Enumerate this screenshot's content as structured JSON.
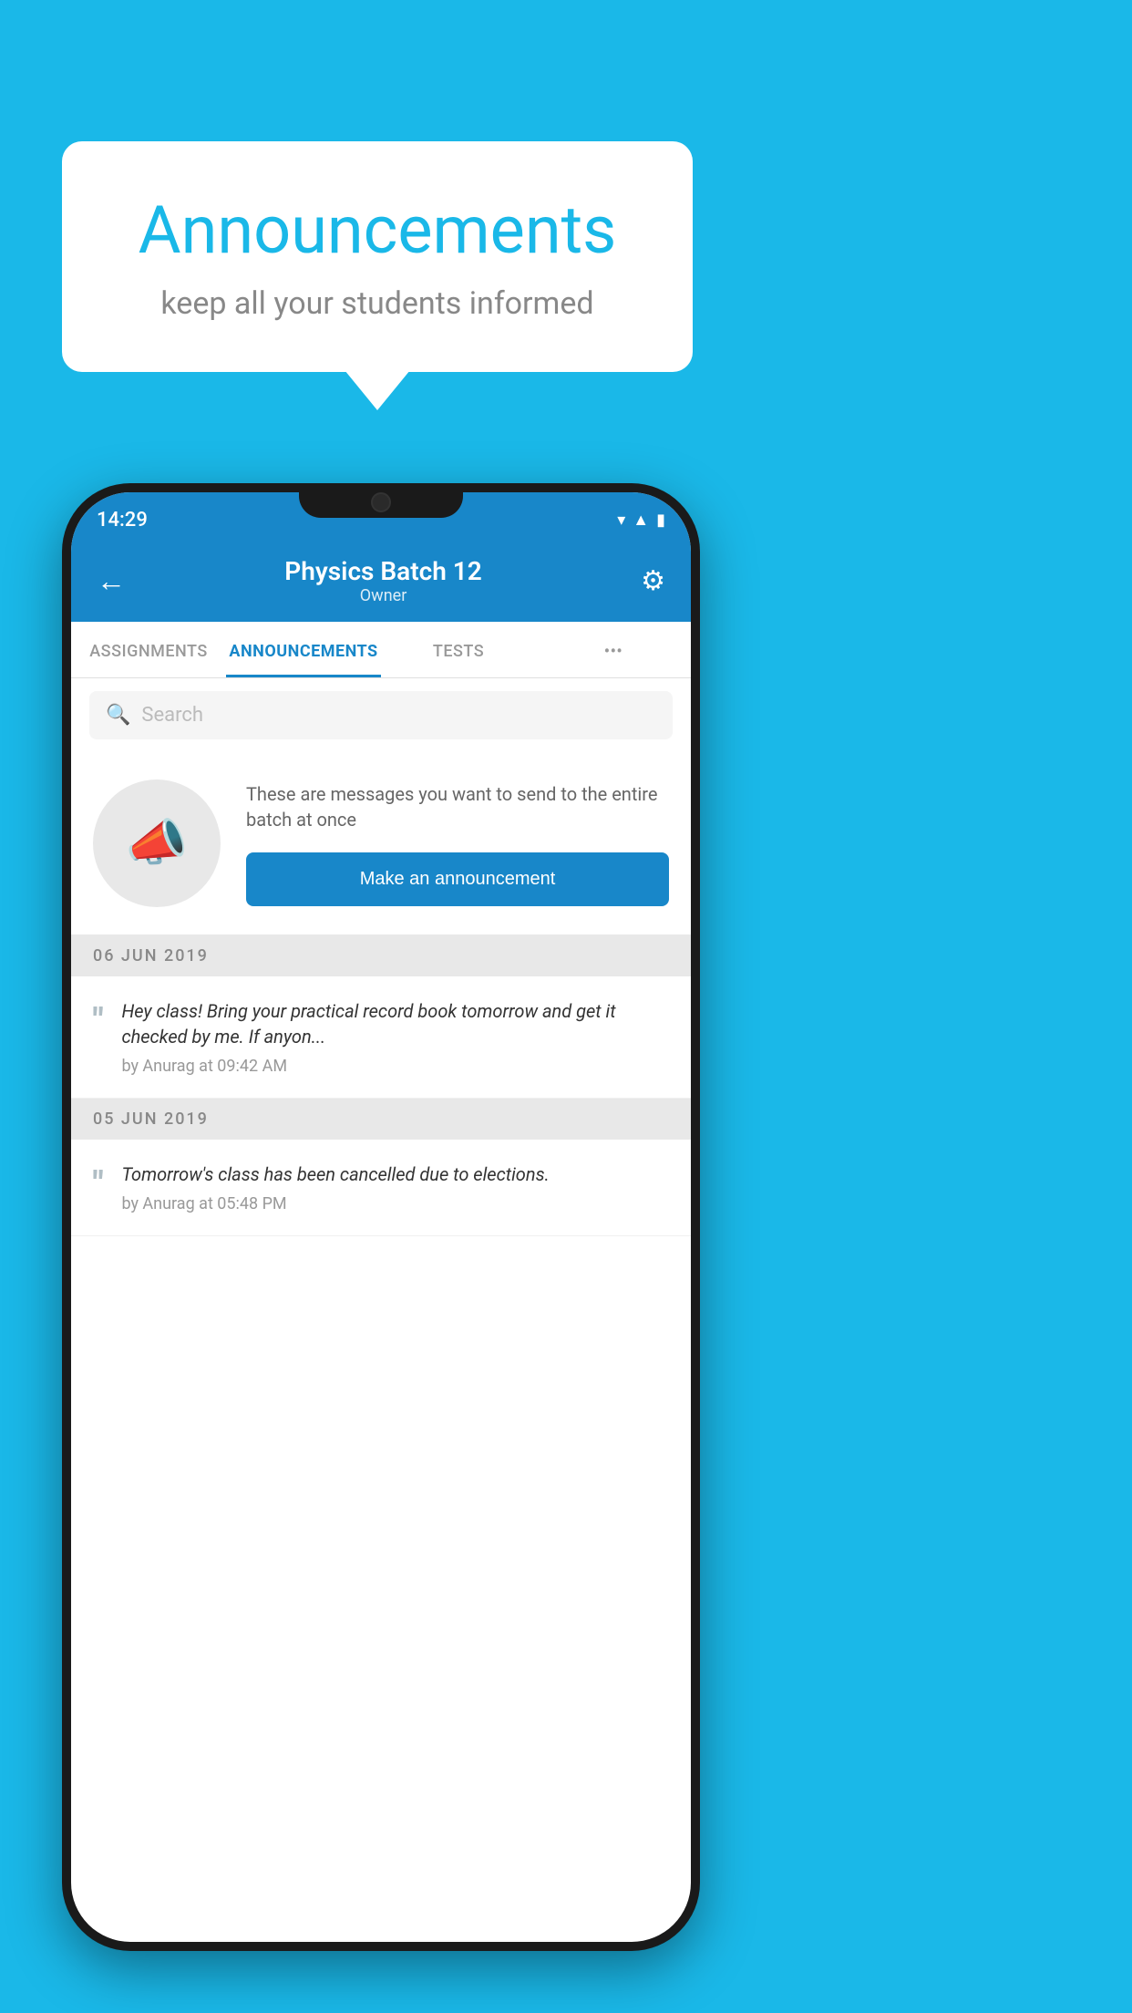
{
  "background_color": "#1ab8e8",
  "speech_bubble": {
    "title": "Announcements",
    "subtitle": "keep all your students informed"
  },
  "status_bar": {
    "time": "14:29",
    "icons": [
      "wifi",
      "signal",
      "battery"
    ]
  },
  "header": {
    "title": "Physics Batch 12",
    "subtitle": "Owner",
    "back_label": "←",
    "gear_label": "⚙"
  },
  "tabs": [
    {
      "label": "ASSIGNMENTS",
      "active": false
    },
    {
      "label": "ANNOUNCEMENTS",
      "active": true
    },
    {
      "label": "TESTS",
      "active": false
    },
    {
      "label": "•••",
      "active": false
    }
  ],
  "search": {
    "placeholder": "Search"
  },
  "announcement_prompt": {
    "description": "These are messages you want to send to the entire batch at once",
    "button_label": "Make an announcement"
  },
  "date_groups": [
    {
      "date": "06  JUN  2019",
      "items": [
        {
          "message": "Hey class! Bring your practical record book tomorrow and get it checked by me. If anyon...",
          "author": "by Anurag at 09:42 AM"
        }
      ]
    },
    {
      "date": "05  JUN  2019",
      "items": [
        {
          "message": "Tomorrow's class has been cancelled due to elections.",
          "author": "by Anurag at 05:48 PM"
        }
      ]
    }
  ]
}
